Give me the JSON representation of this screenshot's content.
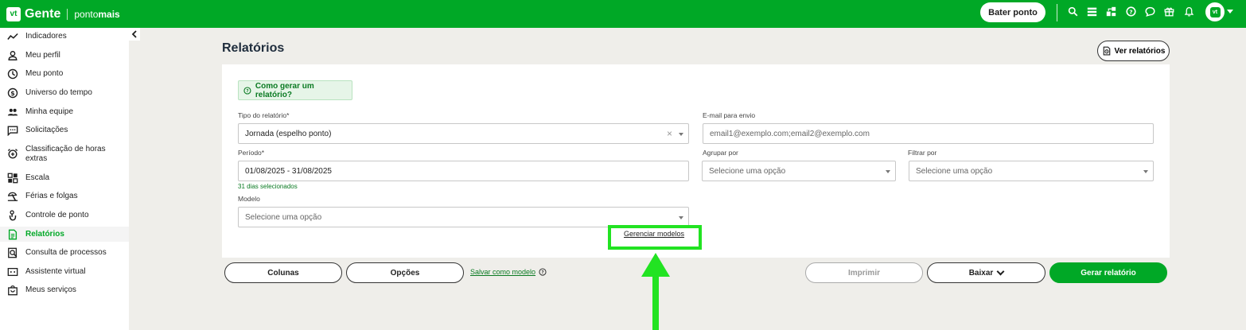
{
  "topbar": {
    "logo_mark": "vt",
    "logo_gente": "Gente",
    "logo_ponto": "ponto",
    "logo_mais": "mais",
    "bater_ponto": "Bater ponto",
    "icons": [
      "search-icon",
      "grid-icon",
      "share-icon",
      "help-icon",
      "chat-icon",
      "gift-icon",
      "bell-icon"
    ],
    "avatar": "vt"
  },
  "sidebar": {
    "items": [
      {
        "label": "Indicadores",
        "icon": "chart-line-icon"
      },
      {
        "label": "Meu perfil",
        "icon": "user-icon"
      },
      {
        "label": "Meu ponto",
        "icon": "clock-icon"
      },
      {
        "label": "Universo do tempo",
        "icon": "dollar-icon"
      },
      {
        "label": "Minha equipe",
        "icon": "team-icon"
      },
      {
        "label": "Solicitações",
        "icon": "message-icon"
      },
      {
        "label": "Classificação de horas extras",
        "icon": "alarm-plus-icon"
      },
      {
        "label": "Escala",
        "icon": "schedule-icon"
      },
      {
        "label": "Férias e folgas",
        "icon": "beach-icon"
      },
      {
        "label": "Controle de ponto",
        "icon": "hand-icon"
      },
      {
        "label": "Relatórios",
        "icon": "document-icon",
        "active": true
      },
      {
        "label": "Consulta de processos",
        "icon": "search-doc-icon"
      },
      {
        "label": "Assistente virtual",
        "icon": "robot-icon"
      },
      {
        "label": "Meus serviços",
        "icon": "bag-icon"
      }
    ]
  },
  "main": {
    "title": "Relatórios",
    "ver_relatorios": "Ver relatórios",
    "howto": "Como gerar um relatório?",
    "tipo_label": "Tipo do relatório*",
    "tipo_value": "Jornada (espelho ponto)",
    "email_label": "E-mail para envio",
    "email_placeholder": "email1@exemplo.com;email2@exemplo.com",
    "periodo_label": "Período*",
    "periodo_value": "01/08/2025 - 31/08/2025",
    "periodo_hint": "31 dias selecionados",
    "agrupar_label": "Agrupar por",
    "agrupar_placeholder": "Selecione uma opção",
    "filtrar_label": "Filtrar por",
    "filtrar_placeholder": "Selecione uma opção",
    "modelo_label": "Modelo",
    "modelo_placeholder": "Selecione uma opção",
    "gerenciar_modelos": "Gerenciar modelos",
    "highlight_color": "#22e322"
  },
  "actions": {
    "colunas": "Colunas",
    "opcoes": "Opções",
    "salvar_modelo": "Salvar como modelo",
    "imprimir": "Imprimir",
    "baixar": "Baixar",
    "gerar": "Gerar relatório"
  },
  "colors": {
    "brand_green": "#00a826",
    "link_green": "#0a7a22"
  }
}
